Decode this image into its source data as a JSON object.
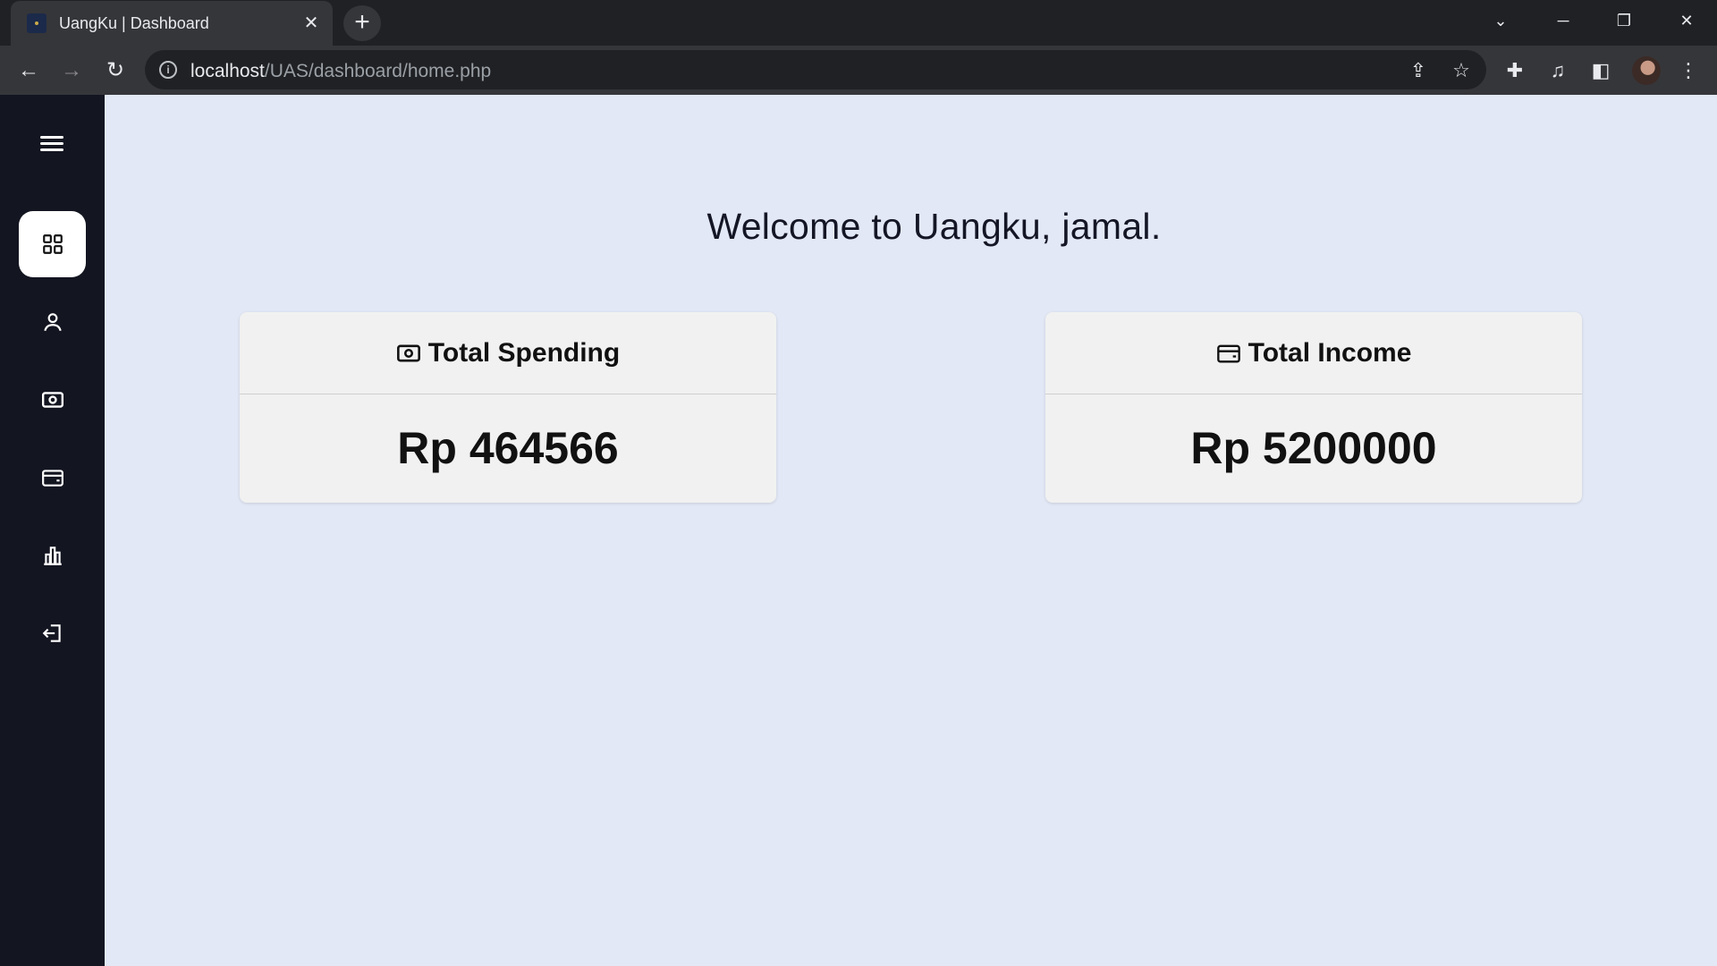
{
  "browser": {
    "tab_title": "UangKu | Dashboard",
    "url_host": "localhost",
    "url_path": "/UAS/dashboard/home.php"
  },
  "sidebar": {
    "items": [
      {
        "name": "dashboard",
        "icon": "grid-icon",
        "active": true
      },
      {
        "name": "profile",
        "icon": "user-icon",
        "active": false
      },
      {
        "name": "spending",
        "icon": "money-icon",
        "active": false
      },
      {
        "name": "income",
        "icon": "wallet-icon",
        "active": false
      },
      {
        "name": "report",
        "icon": "bar-chart-icon",
        "active": false
      },
      {
        "name": "logout",
        "icon": "logout-icon",
        "active": false
      }
    ]
  },
  "main": {
    "welcome": "Welcome to Uangku, jamal.",
    "cards": [
      {
        "title": "Total Spending",
        "icon": "money-icon",
        "value": "Rp 464566"
      },
      {
        "title": "Total Income",
        "icon": "wallet-icon",
        "value": "Rp 5200000"
      }
    ]
  }
}
